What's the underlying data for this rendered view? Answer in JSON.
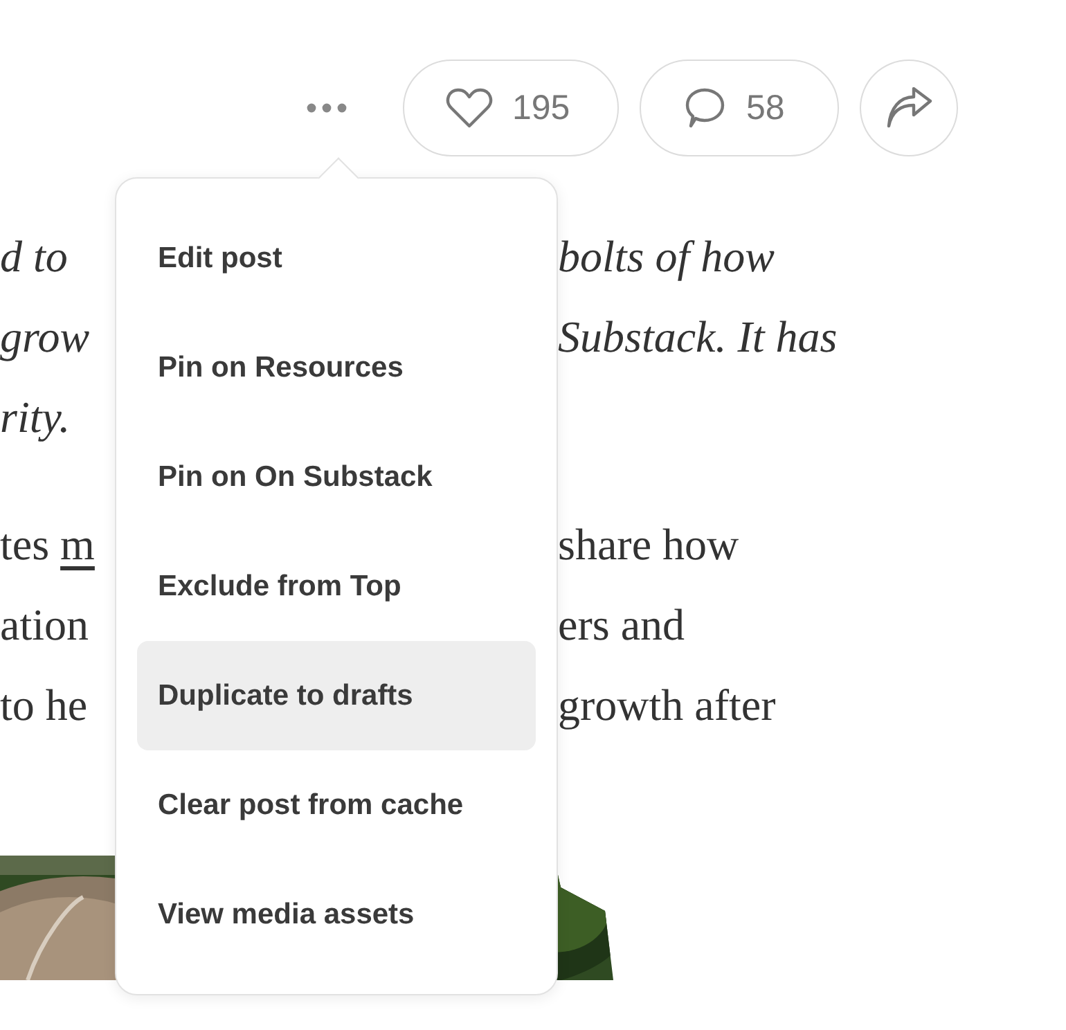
{
  "toolbar": {
    "like_count": "195",
    "comment_count": "58"
  },
  "article": {
    "paragraphs": [
      {
        "italic": true,
        "lines": [
          {
            "left": "d to",
            "right": "bolts of how"
          },
          {
            "left": "grow",
            "right": "Substack. It has"
          },
          {
            "left": "rity."
          }
        ]
      },
      {
        "italic": false,
        "lines": [
          {
            "left": "tes",
            "link": "m",
            "right": "share how"
          },
          {
            "left": "ation",
            "right": "ers and"
          },
          {
            "left": "to he",
            "right": "growth after"
          }
        ]
      }
    ]
  },
  "menu": {
    "items": [
      {
        "label": "Edit post",
        "highlighted": false
      },
      {
        "label": "Pin on Resources",
        "highlighted": false
      },
      {
        "label": "Pin on On Substack",
        "highlighted": false
      },
      {
        "label": "Exclude from Top",
        "highlighted": false
      },
      {
        "label": "Duplicate to drafts",
        "highlighted": true
      },
      {
        "label": "Clear post from cache",
        "highlighted": false
      },
      {
        "label": "View media assets",
        "highlighted": false
      }
    ]
  }
}
